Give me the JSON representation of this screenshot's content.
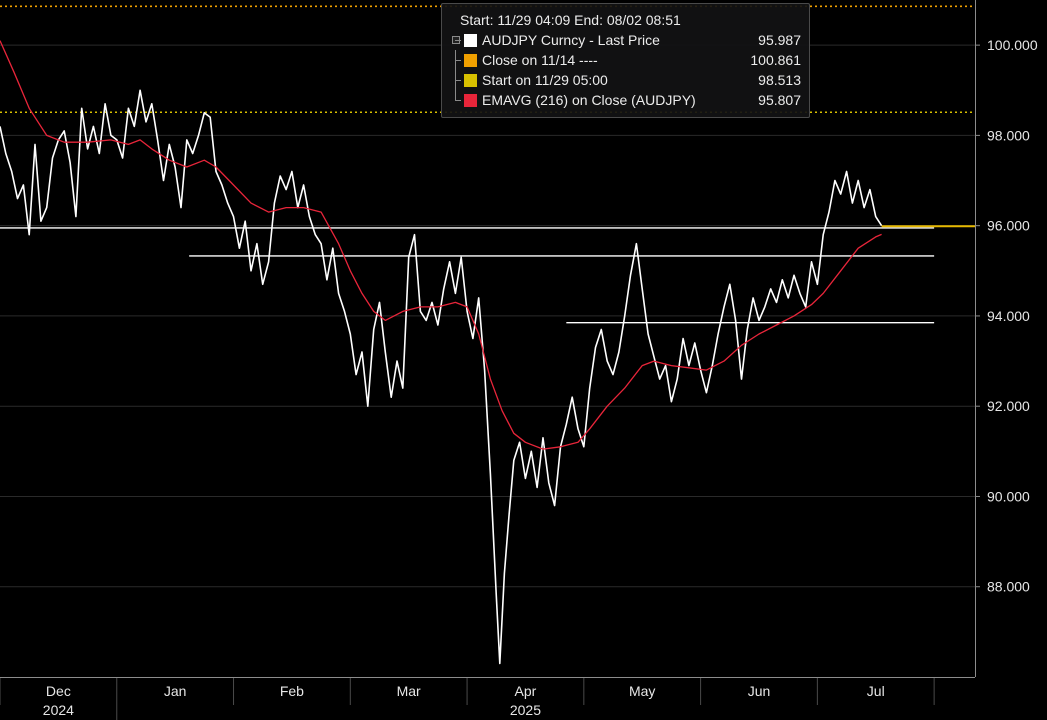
{
  "legend": {
    "header": "Start: 11/29 04:09 End: 08/02 08:51",
    "items": [
      {
        "label": "AUDJPY Curncy - Last Price",
        "value": "95.987",
        "color": "#ffffff"
      },
      {
        "label": "Close on 11/14 ----",
        "value": "100.861",
        "color": "#f0a000"
      },
      {
        "label": "Start on 11/29 05:00",
        "value": "98.513",
        "color": "#d8c000"
      },
      {
        "label": "EMAVG (216)  on Close (AUDJPY)",
        "value": "95.807",
        "color": "#e8253a"
      }
    ]
  },
  "chart_data": {
    "type": "line",
    "ylim": [
      86.0,
      101.0
    ],
    "yticks": [
      "88.000",
      "90.000",
      "92.000",
      "94.000",
      "96.000",
      "98.000",
      "100.000"
    ],
    "ytick_values": [
      88,
      90,
      92,
      94,
      96,
      98,
      100
    ],
    "xticks": [
      {
        "label": "Dec",
        "year": "2024",
        "x": 0.5
      },
      {
        "label": "Jan",
        "year": "",
        "x": 1.5
      },
      {
        "label": "Feb",
        "year": "",
        "x": 2.5
      },
      {
        "label": "Mar",
        "year": "",
        "x": 3.5
      },
      {
        "label": "Apr",
        "year": "2025",
        "x": 4.5
      },
      {
        "label": "May",
        "year": "",
        "x": 5.5
      },
      {
        "label": "Jun",
        "year": "",
        "x": 6.5
      },
      {
        "label": "Jul",
        "year": "",
        "x": 7.5
      }
    ],
    "x_dividers": [
      0,
      1,
      2,
      3,
      4,
      5,
      6,
      7,
      8
    ],
    "year_divider_x": 1,
    "xlim": [
      0,
      8.35
    ],
    "reference_lines": [
      {
        "name": "Close on 11/14",
        "y": 100.861,
        "color": "#f0a000",
        "dash": true
      },
      {
        "name": "Start on 11/29",
        "y": 98.513,
        "color": "#d8c000",
        "dash": true
      },
      {
        "name": "level_96",
        "y": 95.95,
        "x0": 0,
        "x1": 8.0,
        "color": "#ffffff"
      },
      {
        "name": "level_95_3",
        "y": 95.33,
        "x0": 1.62,
        "x1": 8.0,
        "color": "#ffffff"
      },
      {
        "name": "level_93_8",
        "y": 93.85,
        "x0": 4.85,
        "x1": 8.0,
        "color": "#ffffff"
      }
    ],
    "series": [
      {
        "name": "AUDJPY Curncy - Last Price",
        "color": "#ffffff",
        "points": [
          [
            0.0,
            98.2
          ],
          [
            0.05,
            97.6
          ],
          [
            0.1,
            97.2
          ],
          [
            0.15,
            96.6
          ],
          [
            0.2,
            96.9
          ],
          [
            0.25,
            95.8
          ],
          [
            0.3,
            97.8
          ],
          [
            0.35,
            96.1
          ],
          [
            0.4,
            96.4
          ],
          [
            0.45,
            97.5
          ],
          [
            0.5,
            97.9
          ],
          [
            0.55,
            98.1
          ],
          [
            0.6,
            97.4
          ],
          [
            0.65,
            96.2
          ],
          [
            0.7,
            98.6
          ],
          [
            0.75,
            97.7
          ],
          [
            0.8,
            98.2
          ],
          [
            0.85,
            97.6
          ],
          [
            0.9,
            98.7
          ],
          [
            0.95,
            98.0
          ],
          [
            1.0,
            97.9
          ],
          [
            1.05,
            97.5
          ],
          [
            1.1,
            98.6
          ],
          [
            1.15,
            98.2
          ],
          [
            1.2,
            99.0
          ],
          [
            1.25,
            98.3
          ],
          [
            1.3,
            98.7
          ],
          [
            1.35,
            97.9
          ],
          [
            1.4,
            97.0
          ],
          [
            1.45,
            97.8
          ],
          [
            1.5,
            97.3
          ],
          [
            1.55,
            96.4
          ],
          [
            1.6,
            97.9
          ],
          [
            1.65,
            97.6
          ],
          [
            1.7,
            98.0
          ],
          [
            1.75,
            98.5
          ],
          [
            1.8,
            98.4
          ],
          [
            1.85,
            97.2
          ],
          [
            1.9,
            96.9
          ],
          [
            1.95,
            96.5
          ],
          [
            2.0,
            96.2
          ],
          [
            2.05,
            95.5
          ],
          [
            2.1,
            96.1
          ],
          [
            2.15,
            95.0
          ],
          [
            2.2,
            95.6
          ],
          [
            2.25,
            94.7
          ],
          [
            2.3,
            95.2
          ],
          [
            2.35,
            96.5
          ],
          [
            2.4,
            97.1
          ],
          [
            2.45,
            96.8
          ],
          [
            2.5,
            97.2
          ],
          [
            2.55,
            96.4
          ],
          [
            2.6,
            96.9
          ],
          [
            2.65,
            96.2
          ],
          [
            2.7,
            95.8
          ],
          [
            2.75,
            95.6
          ],
          [
            2.8,
            94.8
          ],
          [
            2.85,
            95.5
          ],
          [
            2.9,
            94.5
          ],
          [
            2.95,
            94.1
          ],
          [
            3.0,
            93.6
          ],
          [
            3.05,
            92.7
          ],
          [
            3.1,
            93.2
          ],
          [
            3.15,
            92.0
          ],
          [
            3.2,
            93.7
          ],
          [
            3.25,
            94.3
          ],
          [
            3.3,
            93.2
          ],
          [
            3.35,
            92.2
          ],
          [
            3.4,
            93.0
          ],
          [
            3.45,
            92.4
          ],
          [
            3.5,
            95.3
          ],
          [
            3.55,
            95.8
          ],
          [
            3.6,
            94.1
          ],
          [
            3.65,
            93.9
          ],
          [
            3.7,
            94.3
          ],
          [
            3.75,
            93.8
          ],
          [
            3.8,
            94.6
          ],
          [
            3.85,
            95.2
          ],
          [
            3.9,
            94.5
          ],
          [
            3.95,
            95.3
          ],
          [
            4.0,
            94.1
          ],
          [
            4.05,
            93.5
          ],
          [
            4.1,
            94.4
          ],
          [
            4.15,
            92.8
          ],
          [
            4.2,
            90.5
          ],
          [
            4.25,
            87.8
          ],
          [
            4.28,
            86.3
          ],
          [
            4.32,
            88.3
          ],
          [
            4.36,
            89.6
          ],
          [
            4.4,
            90.8
          ],
          [
            4.45,
            91.2
          ],
          [
            4.5,
            90.4
          ],
          [
            4.55,
            91.0
          ],
          [
            4.6,
            90.2
          ],
          [
            4.65,
            91.3
          ],
          [
            4.7,
            90.3
          ],
          [
            4.75,
            89.8
          ],
          [
            4.8,
            91.1
          ],
          [
            4.85,
            91.6
          ],
          [
            4.9,
            92.2
          ],
          [
            4.95,
            91.5
          ],
          [
            5.0,
            91.1
          ],
          [
            5.05,
            92.4
          ],
          [
            5.1,
            93.3
          ],
          [
            5.15,
            93.7
          ],
          [
            5.2,
            93.0
          ],
          [
            5.25,
            92.7
          ],
          [
            5.3,
            93.2
          ],
          [
            5.35,
            94.0
          ],
          [
            5.4,
            94.9
          ],
          [
            5.45,
            95.6
          ],
          [
            5.5,
            94.6
          ],
          [
            5.55,
            93.6
          ],
          [
            5.6,
            93.1
          ],
          [
            5.65,
            92.6
          ],
          [
            5.7,
            92.9
          ],
          [
            5.75,
            92.1
          ],
          [
            5.8,
            92.6
          ],
          [
            5.85,
            93.5
          ],
          [
            5.9,
            92.9
          ],
          [
            5.95,
            93.4
          ],
          [
            6.0,
            92.8
          ],
          [
            6.05,
            92.3
          ],
          [
            6.1,
            92.9
          ],
          [
            6.15,
            93.6
          ],
          [
            6.2,
            94.2
          ],
          [
            6.25,
            94.7
          ],
          [
            6.3,
            93.9
          ],
          [
            6.35,
            92.6
          ],
          [
            6.4,
            93.7
          ],
          [
            6.45,
            94.4
          ],
          [
            6.5,
            93.9
          ],
          [
            6.55,
            94.2
          ],
          [
            6.6,
            94.6
          ],
          [
            6.65,
            94.3
          ],
          [
            6.7,
            94.8
          ],
          [
            6.75,
            94.4
          ],
          [
            6.8,
            94.9
          ],
          [
            6.85,
            94.5
          ],
          [
            6.9,
            94.2
          ],
          [
            6.95,
            95.2
          ],
          [
            7.0,
            94.7
          ],
          [
            7.05,
            95.8
          ],
          [
            7.1,
            96.3
          ],
          [
            7.15,
            97.0
          ],
          [
            7.2,
            96.7
          ],
          [
            7.25,
            97.2
          ],
          [
            7.3,
            96.5
          ],
          [
            7.35,
            97.0
          ],
          [
            7.4,
            96.4
          ],
          [
            7.45,
            96.8
          ],
          [
            7.5,
            96.2
          ],
          [
            7.55,
            96.0
          ]
        ]
      },
      {
        "name": "EMAVG (216)  on Close (AUDJPY)",
        "color": "#e8253a",
        "points": [
          [
            0.0,
            100.1
          ],
          [
            0.12,
            99.4
          ],
          [
            0.25,
            98.6
          ],
          [
            0.4,
            98.0
          ],
          [
            0.55,
            97.85
          ],
          [
            0.75,
            97.85
          ],
          [
            0.95,
            97.9
          ],
          [
            1.1,
            97.8
          ],
          [
            1.2,
            97.9
          ],
          [
            1.3,
            97.7
          ],
          [
            1.45,
            97.45
          ],
          [
            1.6,
            97.3
          ],
          [
            1.75,
            97.45
          ],
          [
            1.85,
            97.3
          ],
          [
            2.0,
            96.9
          ],
          [
            2.15,
            96.5
          ],
          [
            2.3,
            96.3
          ],
          [
            2.45,
            96.4
          ],
          [
            2.6,
            96.4
          ],
          [
            2.75,
            96.3
          ],
          [
            2.9,
            95.6
          ],
          [
            3.0,
            95.0
          ],
          [
            3.1,
            94.5
          ],
          [
            3.2,
            94.1
          ],
          [
            3.3,
            93.9
          ],
          [
            3.45,
            94.1
          ],
          [
            3.6,
            94.2
          ],
          [
            3.75,
            94.2
          ],
          [
            3.9,
            94.3
          ],
          [
            4.0,
            94.2
          ],
          [
            4.1,
            93.6
          ],
          [
            4.2,
            92.6
          ],
          [
            4.3,
            91.9
          ],
          [
            4.4,
            91.4
          ],
          [
            4.5,
            91.2
          ],
          [
            4.65,
            91.05
          ],
          [
            4.8,
            91.1
          ],
          [
            4.95,
            91.2
          ],
          [
            5.05,
            91.5
          ],
          [
            5.2,
            92.0
          ],
          [
            5.35,
            92.4
          ],
          [
            5.5,
            92.9
          ],
          [
            5.6,
            93.0
          ],
          [
            5.75,
            92.9
          ],
          [
            5.9,
            92.85
          ],
          [
            6.05,
            92.8
          ],
          [
            6.2,
            93.0
          ],
          [
            6.35,
            93.35
          ],
          [
            6.5,
            93.6
          ],
          [
            6.65,
            93.8
          ],
          [
            6.8,
            94.0
          ],
          [
            6.95,
            94.25
          ],
          [
            7.05,
            94.5
          ],
          [
            7.2,
            95.0
          ],
          [
            7.35,
            95.5
          ],
          [
            7.5,
            95.75
          ],
          [
            7.55,
            95.807
          ]
        ]
      }
    ],
    "last_price_tag": {
      "y": 95.987,
      "color": "#e6b800"
    }
  }
}
